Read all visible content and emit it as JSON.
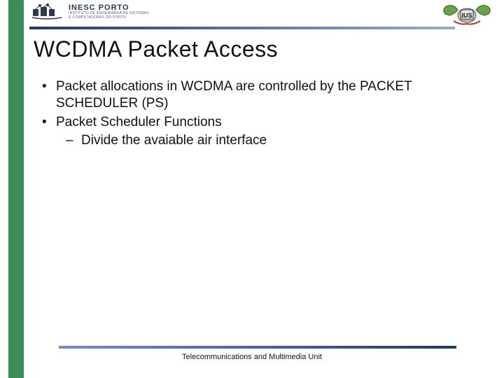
{
  "logo": {
    "title": "INESC PORTO",
    "subtitle_line1": "INSTITUTO DE ENGENHARIA DE SISTEMAS",
    "subtitle_line2": "E COMPUTADORES DO PORTO"
  },
  "slide": {
    "title": "WCDMA Packet Access"
  },
  "bullets": [
    {
      "text": "Packet allocations in WCDMA are controlled by the PACKET SCHEDULER (PS)"
    },
    {
      "text": "Packet Scheduler Functions",
      "sub": [
        {
          "text": "Divide the avaiable air interface"
        }
      ]
    }
  ],
  "footer": "Telecommunications and Multimedia Unit",
  "glyphs": {
    "bullet": "•",
    "dash": "–"
  }
}
